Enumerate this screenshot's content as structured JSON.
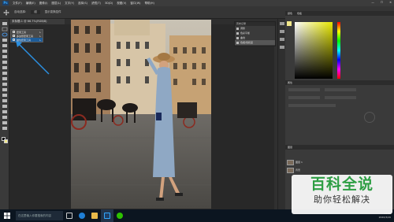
{
  "menubar": {
    "logo": "Ps",
    "items": [
      "文件(F)",
      "编辑(E)",
      "图像(I)",
      "图层(L)",
      "文字(Y)",
      "选择(S)",
      "滤镜(T)",
      "3D(D)",
      "视图(V)",
      "窗口(W)",
      "帮助(H)"
    ],
    "window_controls": [
      "—",
      "☐",
      "✕"
    ]
  },
  "options_bar": {
    "items": [
      "自动选择:",
      "组",
      "显示变换控件"
    ]
  },
  "document_tab": {
    "label": "未标题-1 @ 66.7%(RGB/8)"
  },
  "flyout": {
    "items": [
      {
        "label": "套索工具",
        "key": "L"
      },
      {
        "label": "多边形套索工具",
        "key": "L"
      },
      {
        "label": "磁性套索工具",
        "key": "L"
      }
    ],
    "selected_index": 2
  },
  "history_panel": {
    "title": "历史记录",
    "items": [
      "调整",
      "色彩平衡",
      "曲线",
      "色相/饱和度"
    ]
  },
  "right_panel": {
    "tabs": [
      "颜色",
      "色板"
    ],
    "sections": {
      "properties": "属性",
      "libraries": "库",
      "layers": "图层"
    },
    "layers": [
      {
        "label": "图层 1"
      },
      {
        "label": "背景"
      }
    ]
  },
  "taskbar": {
    "search_placeholder": "在这里输入你要搜索的内容",
    "time": "11:33",
    "date": "2020/3/26"
  },
  "watermark": {
    "title": "百科全说",
    "subtitle": "助你轻松解决"
  },
  "colors": {
    "accent": "#31a8ff",
    "selection": "#1d5c99",
    "watermark_green": "#2e9e44",
    "foreground_swatch": "#f2e88a"
  }
}
